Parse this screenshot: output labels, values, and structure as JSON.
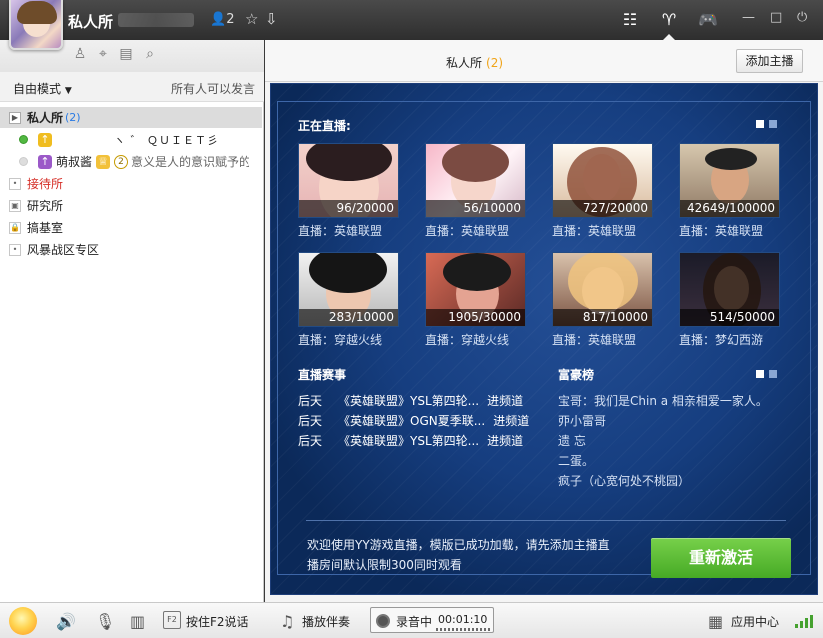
{
  "window": {
    "title": "私人所",
    "member_count": "2"
  },
  "toolbar": {
    "mode_label": "自由模式",
    "mode_note": "所有人可以发言"
  },
  "channel_tree": {
    "root_label": "私人所",
    "root_count": "(2)",
    "user_1_label": "ヽ ゛ ＱＵＩＥＴ彡",
    "user_2_name": "萌叔酱",
    "user_2_level": "2",
    "user_2_status": "意义是人的意识赋予的",
    "items": [
      "接待所",
      "研究所",
      "搞基室",
      "风暴战区专区"
    ]
  },
  "main": {
    "title": "私人所",
    "title_count": "(2)",
    "add_host_button": "添加主播",
    "live_title": "正在直播:",
    "live_cards": [
      {
        "count": "96/20000",
        "label": "直播：英雄联盟"
      },
      {
        "count": "56/10000",
        "label": "直播：英雄联盟"
      },
      {
        "count": "727/20000",
        "label": "直播：英雄联盟"
      },
      {
        "count": "42649/100000",
        "label": "直播：英雄联盟"
      },
      {
        "count": "283/10000",
        "label": "直播：穿越火线"
      },
      {
        "count": "1905/30000",
        "label": "直播：穿越火线"
      },
      {
        "count": "817/10000",
        "label": "直播：英雄联盟"
      },
      {
        "count": "514/50000",
        "label": "直播：梦幻西游"
      }
    ],
    "events_title": "直播赛事",
    "events": [
      {
        "time": "后天",
        "name": "《英雄联盟》YSL第四轮...",
        "action": "进频道"
      },
      {
        "time": "后天",
        "name": "《英雄联盟》OGN夏季联...",
        "action": "进频道"
      },
      {
        "time": "后天",
        "name": "《英雄联盟》YSL第四轮...",
        "action": "进频道"
      }
    ],
    "rich_title": "富豪榜",
    "rich_list": [
      "宝哥：我们是Chin a 相亲相爱一家人。",
      "丣小雷哥",
      "遗 忘",
      "二蛋。",
      "疯子（心宽何处不桃园）"
    ],
    "welcome_text": "欢迎使用YY游戏直播，模版已成功加载，请先添加主播直播房间默认限制300同时观看",
    "reactivate_button": "重新激活"
  },
  "bottom_bar": {
    "talk_label": "按住F2说话",
    "f2_key": "F2",
    "music_label": "播放伴奏",
    "record_label": "录音中",
    "record_time": "00:01:10",
    "app_center": "应用中心"
  },
  "colors": {
    "accent_blue": "#1e4b94",
    "green_button": "#5dbd35",
    "orange_count": "#f0a419"
  }
}
